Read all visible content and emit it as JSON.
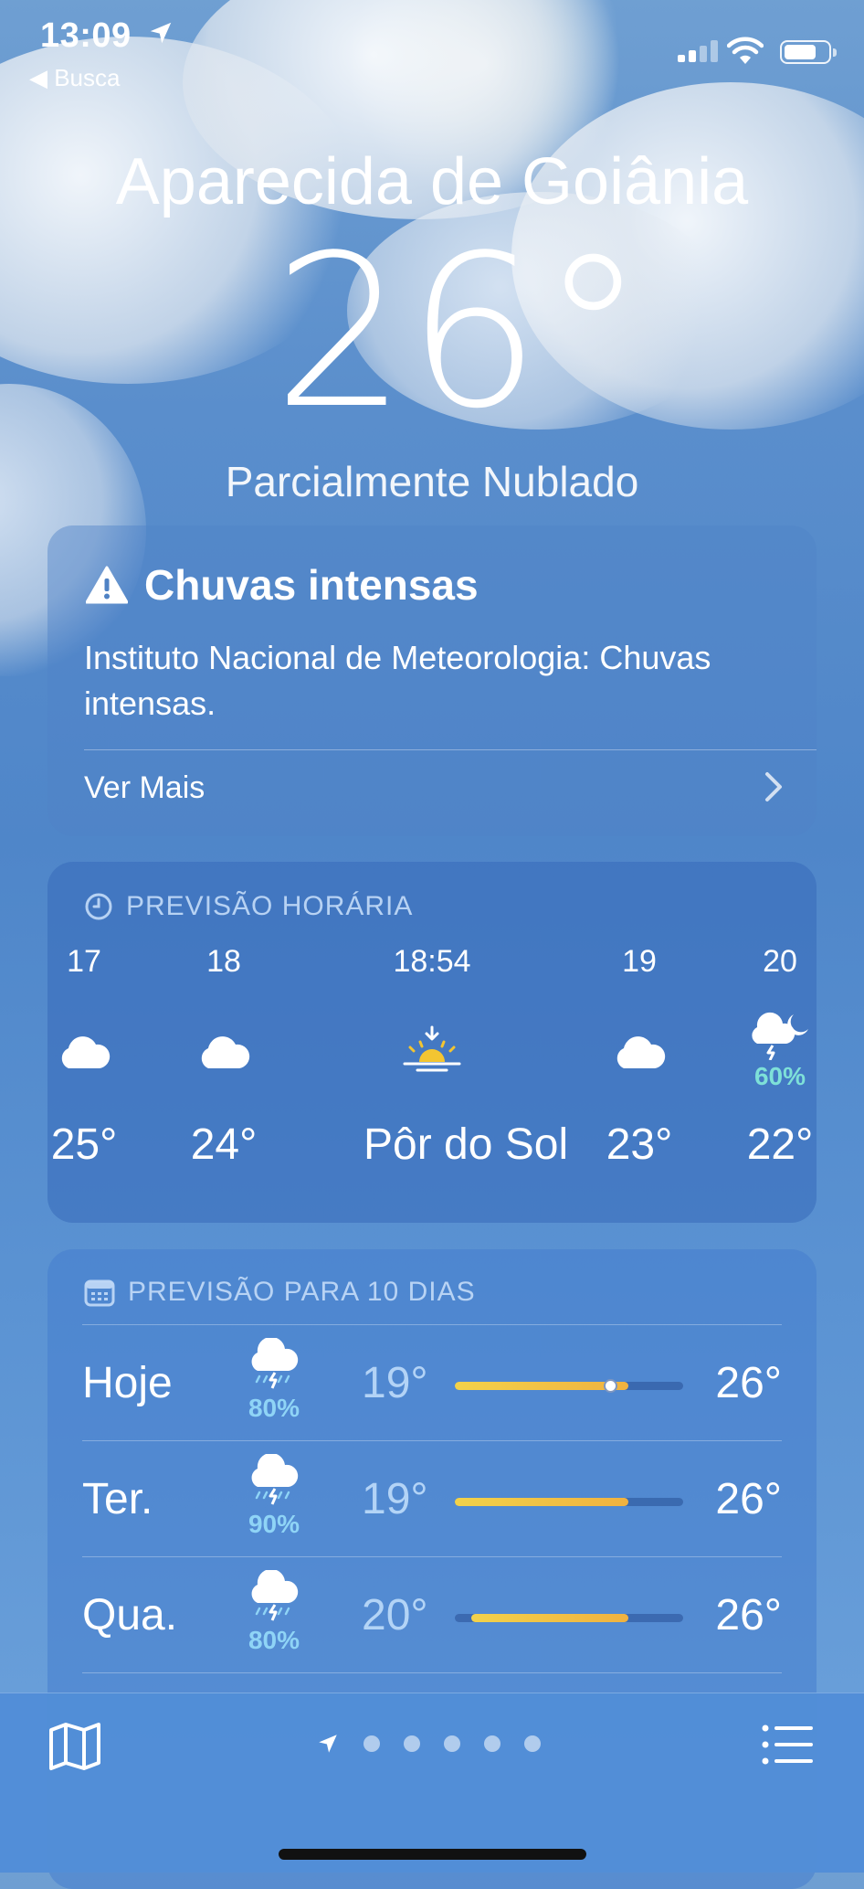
{
  "status_bar": {
    "time": "13:09",
    "back_label": "◀ Busca"
  },
  "header": {
    "city": "Aparecida de Goiânia",
    "temperature": "26°",
    "condition": "Parcialmente Nublado"
  },
  "alert": {
    "title": "Chuvas intensas",
    "body": "Instituto Nacional de Meteorologia: Chuvas intensas.",
    "more_label": "Ver Mais",
    "icon": "warning-icon"
  },
  "hourly": {
    "header": "PREVISÃO HORÁRIA",
    "hours": [
      {
        "hour": "17",
        "icon": "cloud-icon",
        "temp": "25°"
      },
      {
        "hour": "18",
        "icon": "cloud-icon",
        "temp": "24°"
      },
      {
        "hour": "18:54",
        "icon": "sunset-icon",
        "temp": "Pôr do Sol"
      },
      {
        "hour": "19",
        "icon": "cloud-icon",
        "temp": "23°"
      },
      {
        "hour": "20",
        "icon": "thunderstorm-moon-icon",
        "precip": "60%",
        "temp": "22°"
      }
    ]
  },
  "daily": {
    "header": "PREVISÃO PARA 10 DIAS",
    "days": [
      {
        "day": "Hoje",
        "icon": "thunderstorm-icon",
        "precip": "80%",
        "low": "19°",
        "high": "26°",
        "bar_start": 0.0,
        "bar_end": 0.76,
        "current": 0.68
      },
      {
        "day": "Ter.",
        "icon": "thunderstorm-icon",
        "precip": "90%",
        "low": "19°",
        "high": "26°",
        "bar_start": 0.0,
        "bar_end": 0.76
      },
      {
        "day": "Qua.",
        "icon": "thunderstorm-icon",
        "precip": "80%",
        "low": "20°",
        "high": "26°",
        "bar_start": 0.07,
        "bar_end": 0.76
      }
    ]
  },
  "tab_bar": {
    "pages": 5
  },
  "colors": {
    "precip_hourly": "#7ee0d8",
    "precip_daily": "#8fd4f6",
    "temp_bar_start": "#f2d24a",
    "temp_bar_end": "#f0b240"
  }
}
